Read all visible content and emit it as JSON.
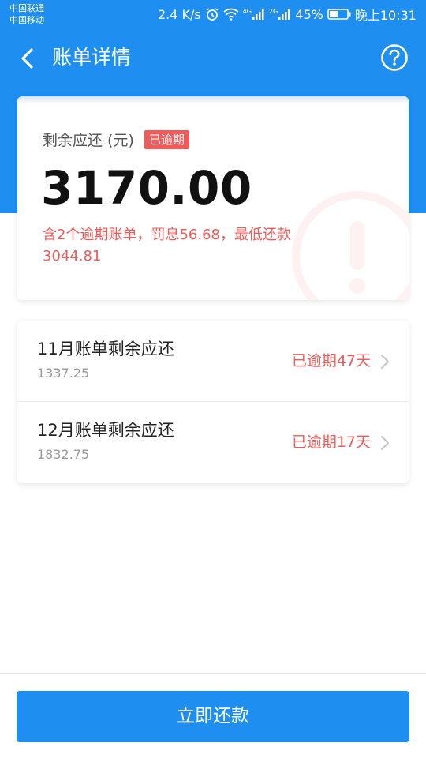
{
  "status_bar": {
    "carrier_1": "中国联通",
    "carrier_2": "中国移动",
    "speed": "2.4 K/s",
    "net_1": "4G",
    "net_2": "2G",
    "battery": "45%",
    "time": "晚上10:31"
  },
  "nav": {
    "title": "账单详情",
    "back_icon": "chevron-left-icon",
    "help_icon": "question-circle-icon"
  },
  "summary": {
    "label": "剩余应还 (元)",
    "badge": "已逾期",
    "amount": "3170.00",
    "note": "含2个逾期账单，罚息56.68，最低还款3044.81"
  },
  "bills": [
    {
      "title": "11月账单剩余应还",
      "amount": "1337.25",
      "status": "已逾期47天"
    },
    {
      "title": "12月账单剩余应还",
      "amount": "1832.75",
      "status": "已逾期17天"
    }
  ],
  "actions": {
    "pay_label": "立即还款"
  },
  "colors": {
    "primary": "#1e8ff0",
    "danger": "#f25a5a"
  }
}
